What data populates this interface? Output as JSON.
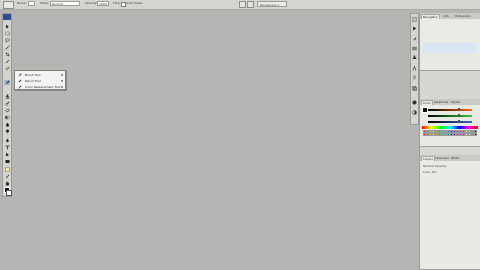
{
  "options_bar": {
    "brush_label": "Brush:",
    "mode_label": "Mode:",
    "mode_value": "Normal",
    "opacity_label": "Opacity:",
    "opacity_value": "100%",
    "flow_label": "Flow:",
    "flow_value": "100%",
    "checkbox_label": "Auto Erase",
    "workspace_label": "Workspace ▾"
  },
  "tool_flyout": {
    "items": [
      {
        "label": "Brush Tool",
        "key": "B",
        "icon": "brush-icon"
      },
      {
        "label": "Pencil Tool",
        "key": "B",
        "icon": "pencil-icon"
      },
      {
        "label": "Color Replacement Tool",
        "key": "B",
        "icon": "color-replacement-icon"
      }
    ]
  },
  "canvas": {
    "text": "· ··"
  },
  "panels": {
    "navigator": {
      "tabs": [
        "Navigator",
        "Info",
        "Histogram"
      ]
    },
    "color": {
      "tabs": [
        "Color",
        "Swatches",
        "Styles"
      ],
      "slider_positions": [
        0.72,
        0.72,
        0.72
      ]
    },
    "layers": {
      "tabs": [
        "Layers",
        "Channels",
        "Paths"
      ],
      "rows": [
        "Normal  Opacity:",
        "Lock:  Fill:"
      ]
    }
  },
  "colors": {
    "workspace_gray": "#b5b6b3",
    "chrome": "#d4d4d0",
    "toolbox_header": "#2d4f90",
    "foreground": "#111111",
    "background": "#ffffff"
  }
}
